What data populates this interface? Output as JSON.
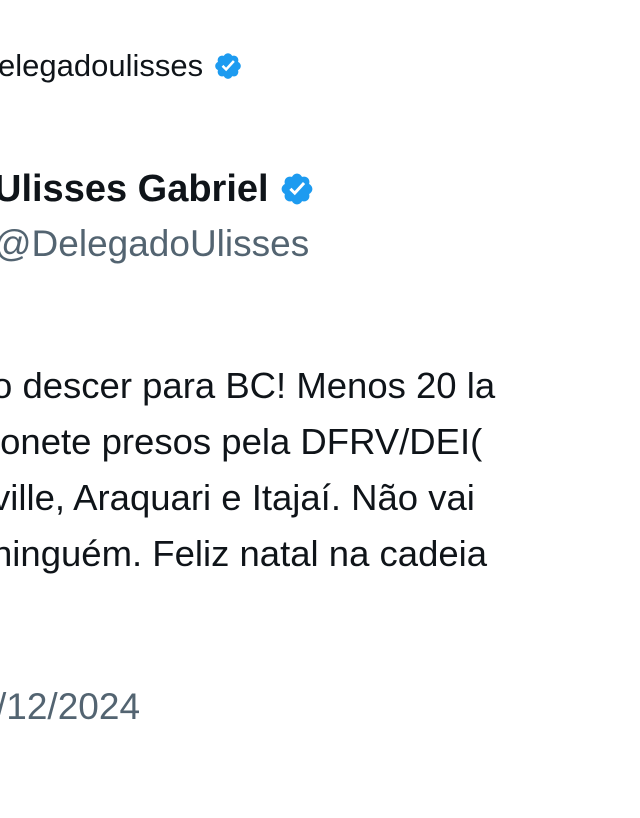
{
  "repost": {
    "handle": "elegadoulisses",
    "verified": true
  },
  "author": {
    "name": "Ulisses Gabriel",
    "handle": "@DelegadoUlisses",
    "verified": true,
    "verified_color": "#1d9bf0"
  },
  "tweet": {
    "lines": [
      "o descer para BC! Menos 20 la",
      "ionete presos pela DFRV/DEI(",
      "ville, Araquari e Itajaí. Não vai",
      "ninguém. Feliz natal na cadeia"
    ]
  },
  "timestamp": "/12/2024"
}
